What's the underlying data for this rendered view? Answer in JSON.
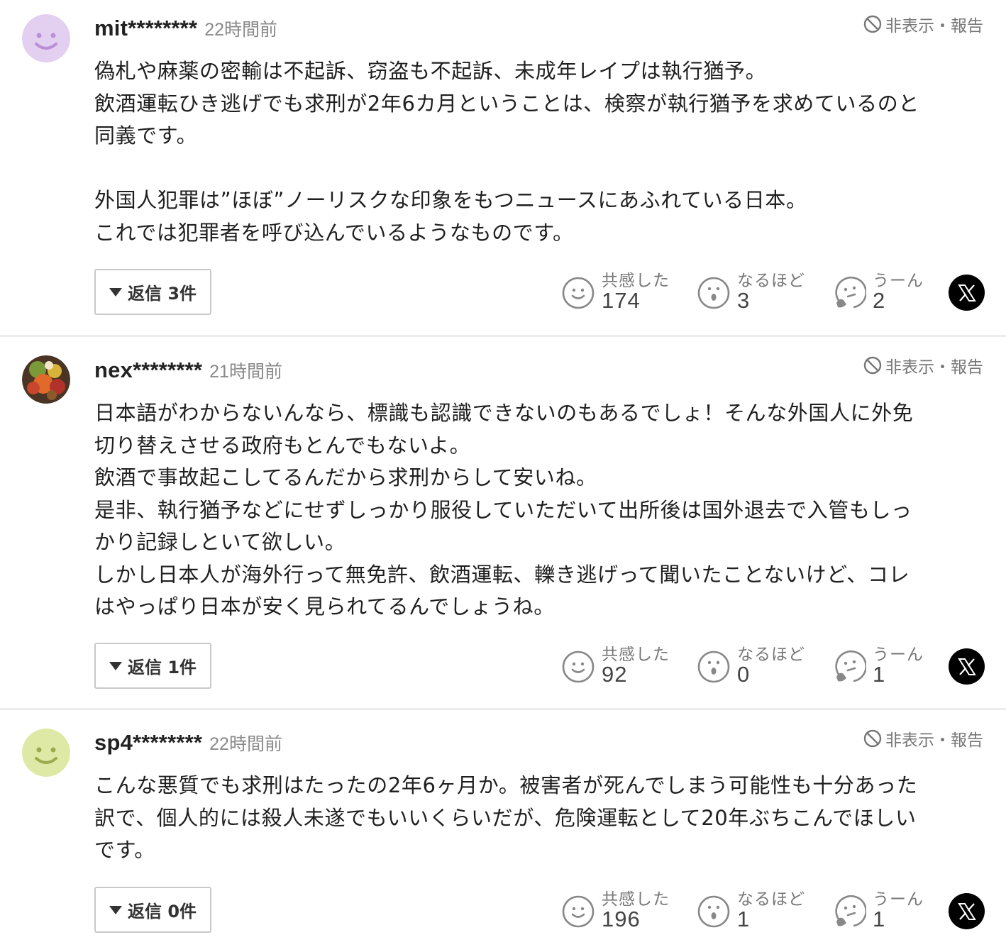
{
  "ui": {
    "hide_report_label": "非表示・報告",
    "reaction_labels": {
      "empathy": "共感した",
      "naruhodo": "なるほど",
      "uun": "うーん"
    },
    "share_icon": "x-logo-icon"
  },
  "comments": [
    {
      "username": "mit********",
      "timestamp": "22時間前",
      "avatar": {
        "type": "smiley",
        "color": "#e3cff0",
        "face_color": "#b98fd8"
      },
      "text": "偽札や麻薬の密輸は不起訴、窃盗も不起訴、未成年レイプは執行猶予。\n飲酒運転ひき逃げでも求刑が2年6カ月ということは、検察が執行猶予を求めているのと\n同義です。\n\n外国人犯罪は”ほぼ”ノーリスクな印象をもつニュースにあふれている日本。\nこれでは犯罪者を呼び込んでいるようなものです。",
      "reply_label": "返信 3件",
      "reactions": {
        "empathy": "174",
        "naruhodo": "3",
        "uun": "2"
      }
    },
    {
      "username": "nex********",
      "timestamp": "21時間前",
      "avatar": {
        "type": "photo",
        "color": "#5a3b2a"
      },
      "text": "日本語がわからないんなら、標識も認識できないのもあるでしょ！そんな外国人に外免\n切り替えさせる政府もとんでもないよ。\n飲酒で事故起こしてるんだから求刑からして安いね。\n是非、執行猶予などにせずしっかり服役していただいて出所後は国外退去で入管もしっ\nかり記録しといて欲しい。\nしかし日本人が海外行って無免許、飲酒運転、轢き逃げって聞いたことないけど、コレ\nはやっぱり日本が安く見られてるんでしょうね。",
      "reply_label": "返信 1件",
      "reactions": {
        "empathy": "92",
        "naruhodo": "0",
        "uun": "1"
      }
    },
    {
      "username": "sp4********",
      "timestamp": "22時間前",
      "avatar": {
        "type": "smiley",
        "color": "#dfe9a6",
        "face_color": "#9aaa4f"
      },
      "text": "こんな悪質でも求刑はたったの2年6ヶ月か。被害者が死んでしまう可能性も十分あった\n訳で、個人的には殺人未遂でもいいくらいだが、危険運転として20年ぶちこんでほしい\nです。",
      "reply_label": "返信 0件",
      "reactions": {
        "empathy": "196",
        "naruhodo": "1",
        "uun": "1"
      }
    }
  ]
}
